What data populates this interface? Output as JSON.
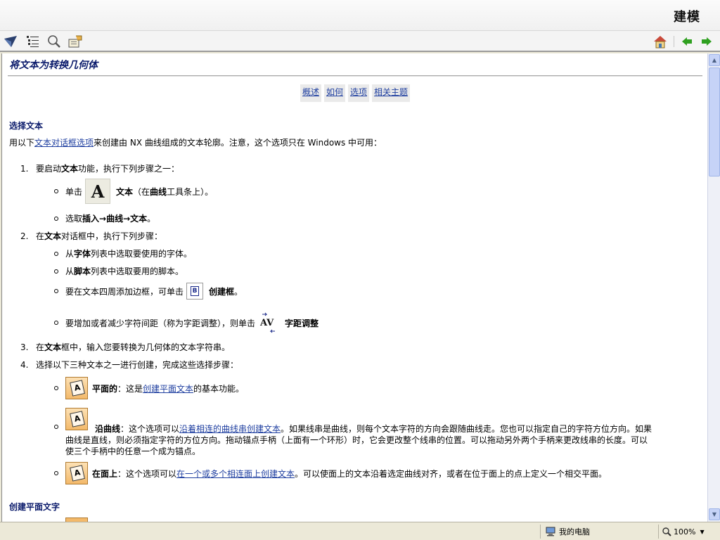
{
  "header": {
    "title": "建模"
  },
  "toolbar": {
    "left_icons": [
      "hide-nav-icon",
      "contents-icon",
      "search-icon",
      "print-icon"
    ],
    "right_icons": [
      "home-icon",
      "back-arrow-icon",
      "forward-arrow-icon"
    ]
  },
  "page": {
    "title": "将文本为转换几何体",
    "nav": [
      "概述",
      "如何",
      "选项",
      "相关主题"
    ],
    "section1": "选择文本",
    "intro_pre": "用以下",
    "intro_link": "文本对话框选项",
    "intro_post": "来创建由  NX 曲线组成的文本轮廓。注意，这个选项只在  Windows 中可用：",
    "step1_num": "1.",
    "step1": {
      "a": "要启动",
      "b": "文本",
      "c": "功能，执行下列步骤之一："
    },
    "icon_a_glyph": "A",
    "b1": {
      "a": "单击",
      "b": "文本",
      "c": "（在",
      "d": "曲线",
      "e": "工具条上）。"
    },
    "b2": {
      "a": "选取",
      "b": "插入→曲线→文本",
      "c": "。"
    },
    "step2_num": "2.",
    "step2": {
      "a": "在",
      "b": "文本",
      "c": "对话框中，执行下列步骤："
    },
    "b3": {
      "a": "从",
      "b": "字体",
      "c": "列表中选取要使用的字体。"
    },
    "b4": {
      "a": "从",
      "b": "脚本",
      "c": "列表中选取要用的脚本。"
    },
    "b5": {
      "a": "要在文本四周添加边框，可单击",
      "b": "创建框",
      "c": "。"
    },
    "icon_box_glyph": "B",
    "b6": {
      "a": "要增加或者减少字符间距（称为字距调整），则单击",
      "b": "字距调整"
    },
    "icon_kern_glyph": "AV",
    "step3_num": "3.",
    "step3": {
      "a": "在",
      "b": "文本",
      "c": "框中，输入您要转换为几何体的文本字符串。"
    },
    "step4_num": "4.",
    "step4": "选择以下三种文本之一进行创建，完成这些选择步骤：",
    "icon_text_glyph": "A",
    "b7": {
      "a": "平面的",
      "b": "：这是",
      "link": "创建平面文本",
      "c": "的基本功能。"
    },
    "b8": {
      "a": "沿曲线",
      "b": "：这个选项可以",
      "link": "沿着相连的曲线串创建文本",
      "c": "。如果线串是曲线，则每个文本字符的方向会跟随曲线走。您也可以指定自己的字符方位方向。如果",
      "d": "曲线是直线，则必须指定字符的方位方向。拖动锚点手柄（上面有一个环形）时，它会更改整个线串的位置。可以拖动另外两个手柄来更改线串的长度。可以",
      "e": "使三个手柄中的任意一个成为锚点。"
    },
    "b9": {
      "a": "在面上",
      "b": "：这个选项可以",
      "link": "在一个或多个相连面上创建文本",
      "c": "。可以使面上的文本沿着选定曲线对齐，或者在位于面上的点上定义一个相交平面。"
    },
    "section2": "创建平面文字"
  },
  "statusbar": {
    "zone": "我的电脑",
    "zoom": "100%"
  }
}
